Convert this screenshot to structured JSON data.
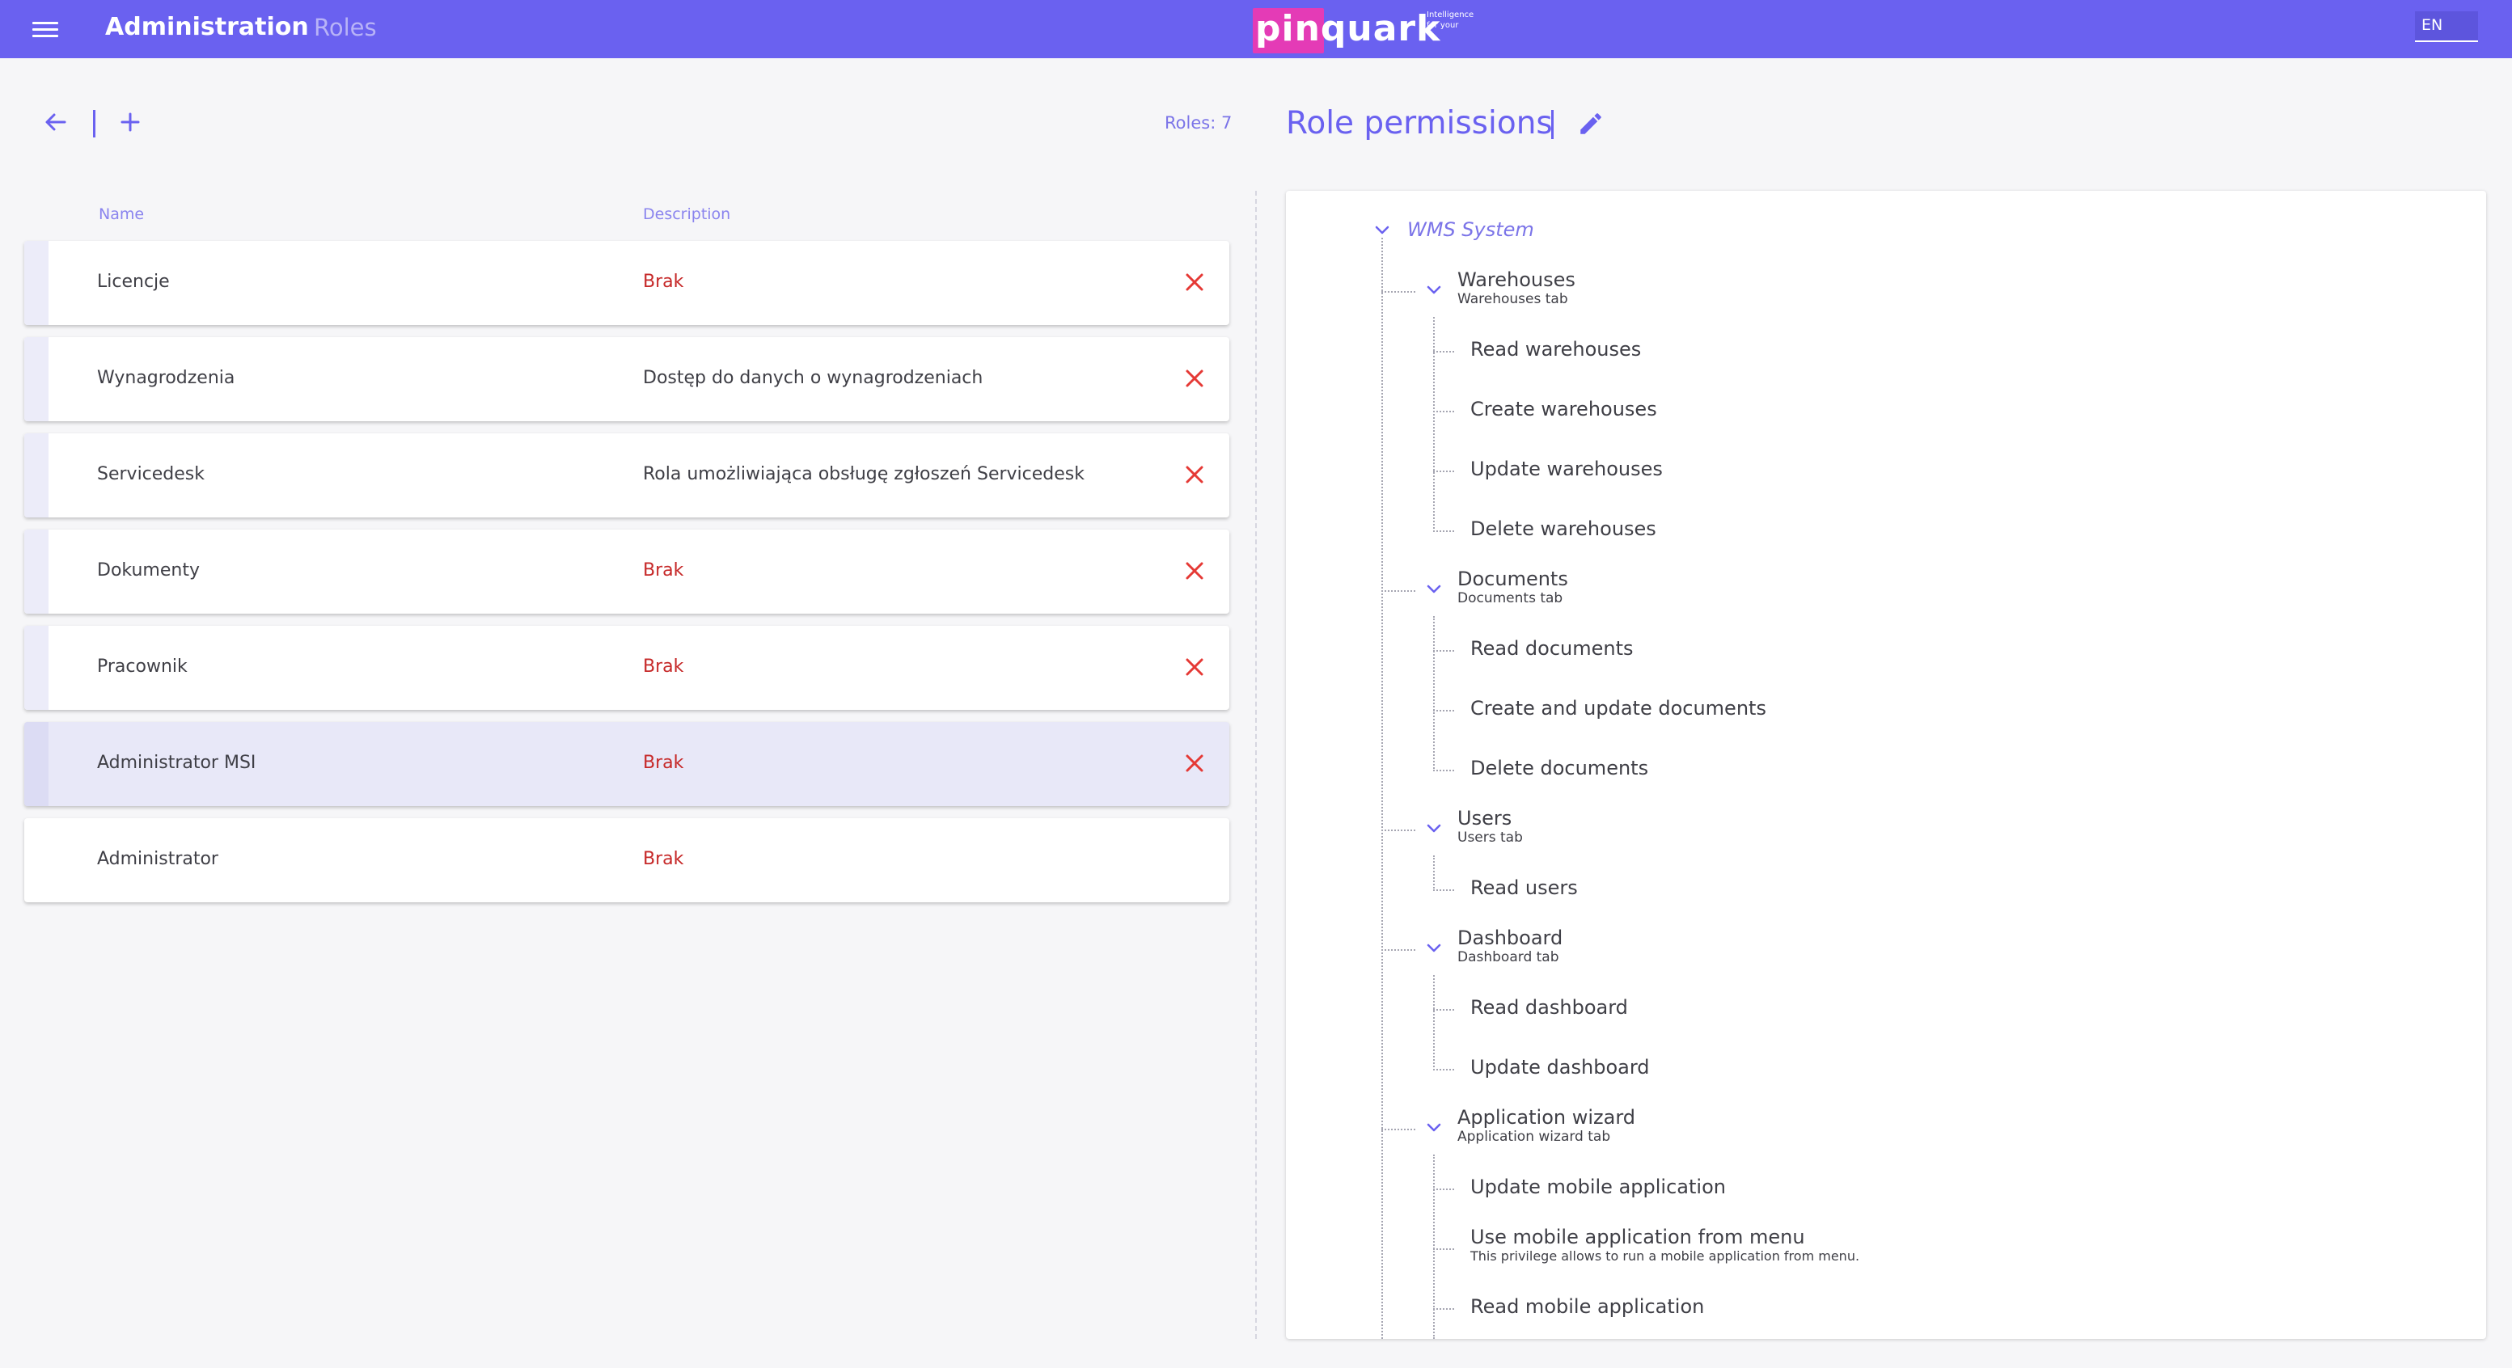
{
  "header": {
    "title": "Administration",
    "subtitle": "Roles",
    "logo_text": "pinquark",
    "logo_tagline_1": "Intelligence",
    "logo_tagline_2": "for your",
    "language": "EN",
    "colors": {
      "bar": "#6a61f0",
      "logo_accent": "#e43bb6"
    }
  },
  "roles_panel": {
    "back_icon": "arrow-left-icon",
    "add_icon": "plus-icon",
    "count_label": "Roles: 7",
    "columns": {
      "name": "Name",
      "description": "Description"
    },
    "rows": [
      {
        "name": "Licencje",
        "description": "Brak",
        "deletable": true,
        "selected": false
      },
      {
        "name": "Wynagrodzenia",
        "description": "Dostęp do danych o wynagrodzeniach",
        "deletable": true,
        "selected": false
      },
      {
        "name": "Servicedesk",
        "description": "Rola umożliwiająca obsługę zgłoszeń Servicedesk",
        "deletable": true,
        "selected": false
      },
      {
        "name": "Dokumenty",
        "description": "Brak",
        "deletable": true,
        "selected": false
      },
      {
        "name": "Pracownik",
        "description": "Brak",
        "deletable": true,
        "selected": false
      },
      {
        "name": "Administrator MSI",
        "description": "Brak",
        "deletable": true,
        "selected": true
      },
      {
        "name": "Administrator",
        "description": "Brak",
        "deletable": false,
        "selected": false
      }
    ]
  },
  "permissions_panel": {
    "title": "Role permissions",
    "edit_icon": "pencil-icon",
    "root": "WMS System",
    "groups": [
      {
        "name": "Warehouses",
        "subtitle": "Warehouses tab",
        "items": [
          {
            "label": "Read warehouses"
          },
          {
            "label": "Create warehouses"
          },
          {
            "label": "Update warehouses"
          },
          {
            "label": "Delete warehouses"
          }
        ]
      },
      {
        "name": "Documents",
        "subtitle": "Documents tab",
        "items": [
          {
            "label": "Read documents"
          },
          {
            "label": "Create and update documents"
          },
          {
            "label": "Delete documents"
          }
        ]
      },
      {
        "name": "Users",
        "subtitle": "Users tab",
        "items": [
          {
            "label": "Read users"
          }
        ]
      },
      {
        "name": "Dashboard",
        "subtitle": "Dashboard tab",
        "items": [
          {
            "label": "Read dashboard"
          },
          {
            "label": "Update dashboard"
          }
        ]
      },
      {
        "name": "Application wizard",
        "subtitle": "Application wizard tab",
        "items": [
          {
            "label": "Update mobile application"
          },
          {
            "label": "Use mobile application from menu",
            "hint": "This privilege allows to run a mobile application from menu."
          },
          {
            "label": "Read mobile application"
          }
        ]
      }
    ]
  }
}
